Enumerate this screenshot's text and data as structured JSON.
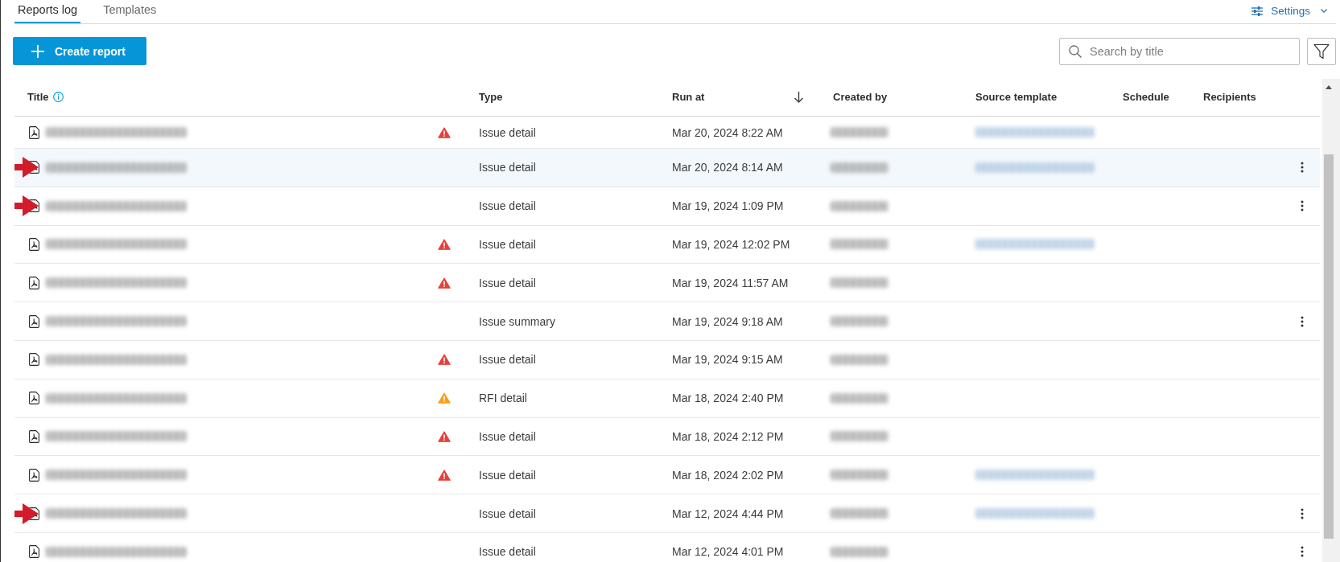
{
  "tabs": [
    {
      "label": "Reports log",
      "selected": true
    },
    {
      "label": "Templates",
      "selected": false
    }
  ],
  "settings": {
    "label": "Settings"
  },
  "toolbar": {
    "create_button": {
      "label": "Create report"
    },
    "search": {
      "placeholder": "Search by title"
    }
  },
  "table": {
    "columns": [
      {
        "label": "Title",
        "info": true,
        "sort_descending": false
      },
      {
        "label": "Type",
        "info": false,
        "sort_descending": false
      },
      {
        "label": "Run at",
        "info": false,
        "sort_descending": true
      },
      {
        "label": "Created by",
        "info": false,
        "sort_descending": false
      },
      {
        "label": "Source template",
        "info": false,
        "sort_descending": false
      },
      {
        "label": "Schedule",
        "info": false,
        "sort_descending": false
      },
      {
        "label": "Recipients",
        "info": false,
        "sort_descending": false
      }
    ],
    "rows": [
      {
        "selected": false,
        "annotated": false,
        "warning": true,
        "color": "#e5413a",
        "type": "Issue detail",
        "run_at": "Mar 20, 2024 8:22 AM",
        "blurred": {
          "title": true,
          "created_by": true,
          "source_template": true
        },
        "menu": false
      },
      {
        "selected": true,
        "annotated": true,
        "warning": false,
        "type": "Issue detail",
        "run_at": "Mar 20, 2024 8:14 AM",
        "blurred": {
          "title": true,
          "created_by": true,
          "source_template": true
        },
        "menu": true
      },
      {
        "selected": false,
        "annotated": true,
        "warning": false,
        "type": "Issue detail",
        "run_at": "Mar 19, 2024 1:09 PM",
        "blurred": {
          "title": true,
          "created_by": true,
          "source_template": false
        },
        "menu": true
      },
      {
        "selected": false,
        "annotated": false,
        "warning": true,
        "color": "#e5413a",
        "type": "Issue detail",
        "run_at": "Mar 19, 2024 12:02 PM",
        "blurred": {
          "title": true,
          "created_by": true,
          "source_template": true
        },
        "menu": false
      },
      {
        "selected": false,
        "annotated": false,
        "warning": true,
        "color": "#e5413a",
        "type": "Issue detail",
        "run_at": "Mar 19, 2024 11:57 AM",
        "blurred": {
          "title": true,
          "created_by": true,
          "source_template": false
        },
        "menu": false
      },
      {
        "selected": false,
        "annotated": false,
        "warning": false,
        "type": "Issue summary",
        "run_at": "Mar 19, 2024 9:18 AM",
        "blurred": {
          "title": true,
          "created_by": true,
          "source_template": false
        },
        "menu": true
      },
      {
        "selected": false,
        "annotated": false,
        "warning": true,
        "color": "#e5413a",
        "type": "Issue detail",
        "run_at": "Mar 19, 2024 9:15 AM",
        "blurred": {
          "title": true,
          "created_by": true,
          "source_template": false
        },
        "menu": false
      },
      {
        "selected": false,
        "annotated": false,
        "warning": true,
        "color": "#f5a01a",
        "type": "RFI detail",
        "run_at": "Mar 18, 2024 2:40 PM",
        "blurred": {
          "title": true,
          "created_by": true,
          "source_template": false
        },
        "menu": false
      },
      {
        "selected": false,
        "annotated": false,
        "warning": true,
        "color": "#e5413a",
        "type": "Issue detail",
        "run_at": "Mar 18, 2024 2:12 PM",
        "blurred": {
          "title": true,
          "created_by": true,
          "source_template": false
        },
        "menu": false
      },
      {
        "selected": false,
        "annotated": false,
        "warning": true,
        "color": "#e5413a",
        "type": "Issue detail",
        "run_at": "Mar 18, 2024 2:02 PM",
        "blurred": {
          "title": true,
          "created_by": true,
          "source_template": true
        },
        "menu": false
      },
      {
        "selected": false,
        "annotated": true,
        "warning": false,
        "type": "Issue detail",
        "run_at": "Mar 12, 2024 4:44 PM",
        "blurred": {
          "title": true,
          "created_by": true,
          "source_template": true
        },
        "menu": true
      },
      {
        "selected": false,
        "annotated": false,
        "warning": false,
        "type": "Issue detail",
        "run_at": "Mar 12, 2024 4:01 PM",
        "blurred": {
          "title": true,
          "created_by": true,
          "source_template": false
        },
        "menu": true
      }
    ]
  }
}
